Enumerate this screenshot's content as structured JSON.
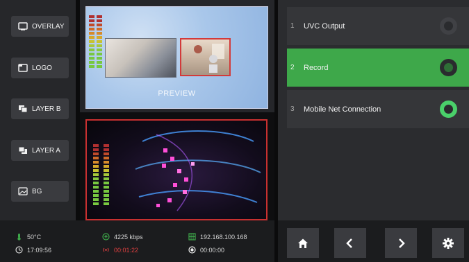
{
  "layers": [
    {
      "label": "OVERLAY",
      "icon": "overlay-icon"
    },
    {
      "label": "LOGO",
      "icon": "logo-icon"
    },
    {
      "label": "LAYER B",
      "icon": "layer-b-icon"
    },
    {
      "label": "LAYER A",
      "icon": "layer-a-icon"
    },
    {
      "label": "BG",
      "icon": "image-icon"
    }
  ],
  "preview": {
    "label": "PREVIEW"
  },
  "status": {
    "temperature": "50°C",
    "time": "17:09:56",
    "bitrate": "4225 kbps",
    "live_timer": "00:01:22",
    "ip": "192.168.100.168",
    "record_timer": "00:00:00"
  },
  "outputs": [
    {
      "num": "1",
      "label": "UVC Output",
      "active": false
    },
    {
      "num": "2",
      "label": "Record",
      "active": true
    },
    {
      "num": "3",
      "label": "Mobile Net Connection",
      "active": true
    }
  ],
  "nav": [
    "home-icon",
    "chevron-left-icon",
    "chevron-right-icon",
    "gear-icon"
  ],
  "colors": {
    "accent_green": "#3ea84a",
    "toggle_on": "#4ad06a",
    "program_border": "#c83030",
    "status_red": "#e04040"
  }
}
